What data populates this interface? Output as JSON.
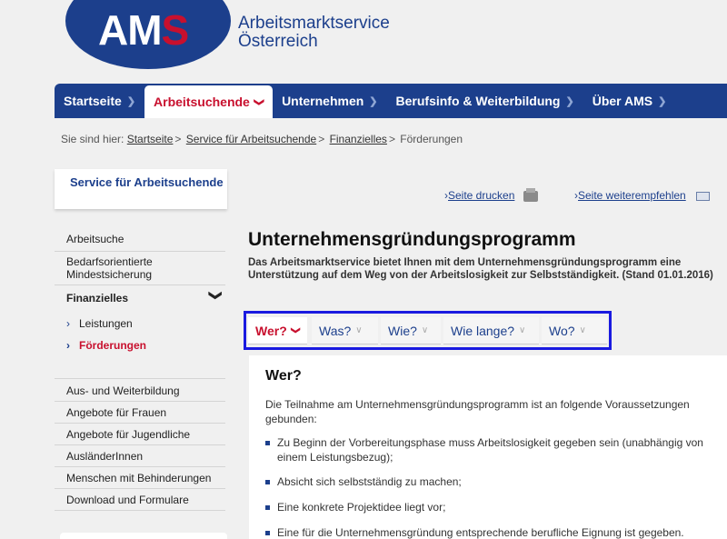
{
  "header": {
    "logo": {
      "am": "AM",
      "s": "S"
    },
    "org_line1": "Arbeitsmarktservice",
    "org_line2": "Österreich"
  },
  "nav": [
    {
      "label": "Startseite"
    },
    {
      "label": "Arbeitsuchende",
      "active": true
    },
    {
      "label": "Unternehmen"
    },
    {
      "label": "Berufsinfo & Weiterbildung"
    },
    {
      "label": "Über AMS"
    }
  ],
  "breadcrumb": {
    "prefix": "Sie sind hier:",
    "items": [
      "Startseite",
      "Service für Arbeitsuchende",
      "Finanzielles"
    ],
    "current": "Förderungen"
  },
  "sidebar": {
    "title": "Service für Arbeitsuchende",
    "items": [
      {
        "label": "Arbeitsuche"
      },
      {
        "label": "Bedarfsorientierte Mindestsicherung"
      },
      {
        "label": "Finanzielles"
      },
      {
        "label": "Leistungen"
      },
      {
        "label": "Förderungen"
      },
      {
        "label": "Aus- und Weiterbildung"
      },
      {
        "label": "Angebote für Frauen"
      },
      {
        "label": "Angebote für Jugendliche"
      },
      {
        "label": "AusländerInnen"
      },
      {
        "label": "Menschen mit Behinderungen"
      },
      {
        "label": "Download und Formulare"
      }
    ]
  },
  "utility": {
    "print": "Seite drucken",
    "recommend": "Seite weiterempfehlen"
  },
  "main": {
    "title": "Unternehmensgründungsprogramm",
    "intro": "Das Arbeitsmarktservice bietet Ihnen mit dem Unternehmensgründungsprogramm eine Unterstützung auf dem Weg von der Arbeitslosigkeit zur Selbstständigkeit. (Stand 01.01.2016)",
    "tabs": [
      {
        "label": "Wer?",
        "active": true
      },
      {
        "label": "Was?"
      },
      {
        "label": "Wie?"
      },
      {
        "label": "Wie lange?"
      },
      {
        "label": "Wo?"
      }
    ],
    "section": {
      "heading": "Wer?",
      "text": "Die Teilnahme am Unternehmensgründungsprogramm ist an folgende Voraussetzungen gebunden:",
      "bullets": [
        "Zu Beginn der Vorbereitungsphase muss Arbeitslosigkeit gegeben sein (unabhängig von einem Leistungsbezug);",
        "Absicht sich selbstständig zu machen;",
        "Eine konkrete Projektidee liegt vor;",
        "Eine für die Unternehmensgründung entsprechende berufliche Eignung ist gegeben."
      ]
    }
  },
  "colors": {
    "brand_blue": "#1c3f8c",
    "brand_red": "#c8102e",
    "highlight": "#1a1ae0"
  }
}
